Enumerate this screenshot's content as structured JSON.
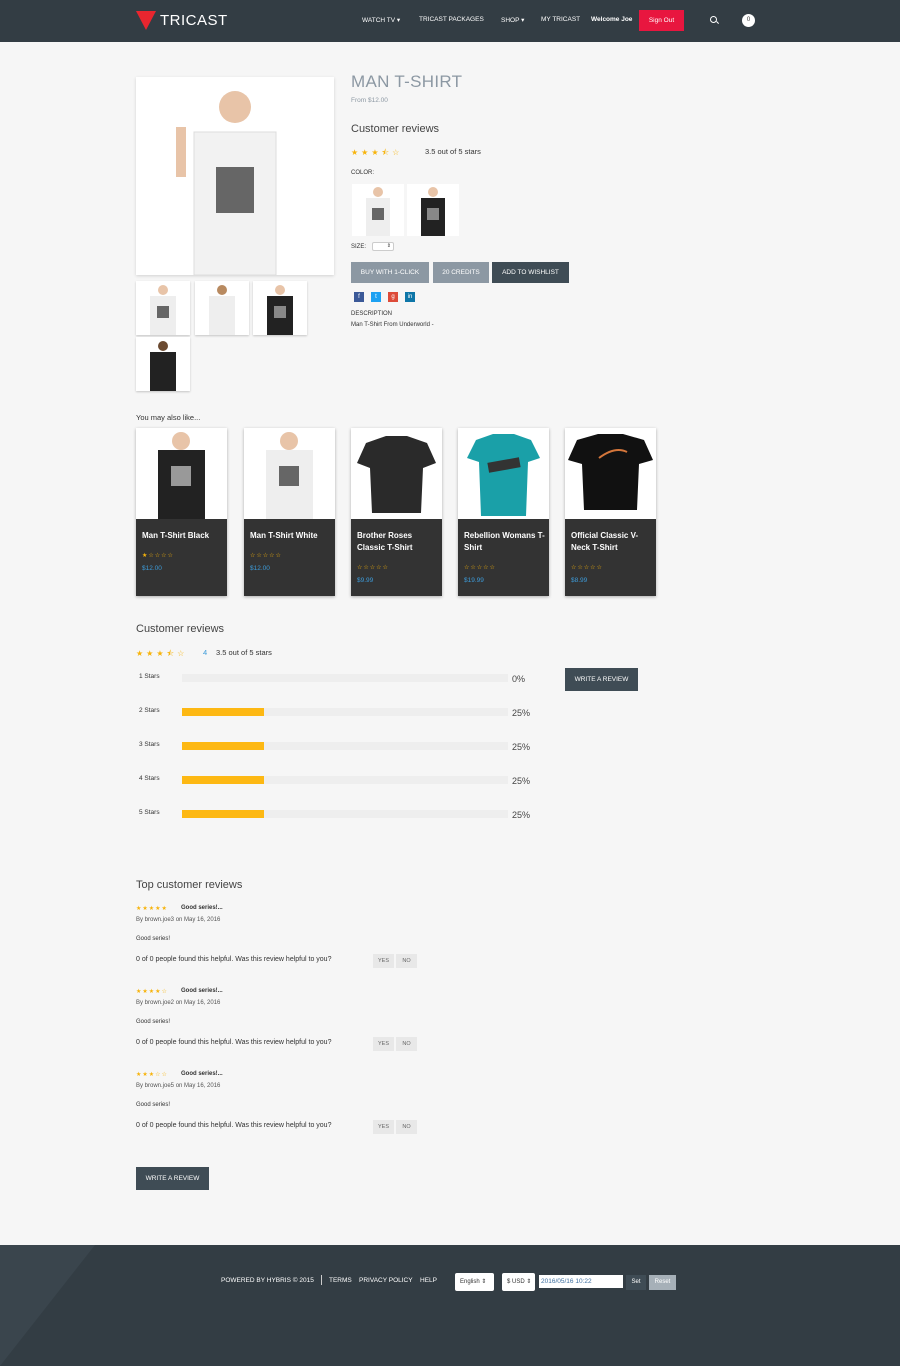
{
  "header": {
    "logo": "TRICAST",
    "nav": [
      "WATCH TV",
      "TRICAST PACKAGES",
      "SHOP",
      "MY TRICAST"
    ],
    "welcome": "Welcome Joe",
    "signout": "Sign Out",
    "cart_count": "0"
  },
  "product": {
    "title": "MAN T-SHIRT",
    "from": "From $12.00",
    "reviews_heading": "Customer reviews",
    "rating_text": "3.5 out of 5 stars",
    "rating": 3.5,
    "color_label": "COLOR:",
    "size_label": "SIZE:",
    "buy_label": "BUY WITH 1-CLICK",
    "credits_label": "20 CREDITS",
    "wishlist_label": "ADD TO WISHLIST",
    "desc_label": "DESCRIPTION",
    "desc_text": "Man T-Shirt From Underworld -"
  },
  "also": {
    "heading": "You may also like...",
    "items": [
      {
        "name": "Man T-Shirt Black",
        "price": "$12.00",
        "rating": 1
      },
      {
        "name": "Man T-Shirt White",
        "price": "$12.00",
        "rating": 0
      },
      {
        "name": "Brother Roses Classic T-Shirt",
        "price": "$9.99",
        "rating": 0
      },
      {
        "name": "Rebellion Womans T-Shirt",
        "price": "$19.99",
        "rating": 0
      },
      {
        "name": "Official Classic V-Neck T-Shirt",
        "price": "$8.99",
        "rating": 0
      }
    ]
  },
  "reviews": {
    "heading": "Customer reviews",
    "count": "4",
    "rating_text": "3.5 out of 5 stars",
    "write_label": "WRITE A REVIEW",
    "bars": [
      {
        "label": "1 Stars",
        "pct": "0%",
        "value": 0
      },
      {
        "label": "2 Stars",
        "pct": "25%",
        "value": 25
      },
      {
        "label": "3 Stars",
        "pct": "25%",
        "value": 25
      },
      {
        "label": "4 Stars",
        "pct": "25%",
        "value": 25
      },
      {
        "label": "5 Stars",
        "pct": "25%",
        "value": 25
      }
    ]
  },
  "top": {
    "heading": "Top customer reviews",
    "helpful": "0 of 0 people found this helpful. Was this review helpful to you?",
    "yes": "YES",
    "no": "NO",
    "write_label": "WRITE A REVIEW",
    "items": [
      {
        "title": "Good series!...",
        "by": "By brown.joe3 on May 16, 2016",
        "body": "Good series!",
        "rating": 5
      },
      {
        "title": "Good series!...",
        "by": "By brown.joe2 on May 16, 2016",
        "body": "Good series!",
        "rating": 4
      },
      {
        "title": "Good series!...",
        "by": "By brown.joe5 on May 16, 2016",
        "body": "Good series!",
        "rating": 3
      }
    ]
  },
  "footer": {
    "powered": "POWERED BY HYBRIS © 2015",
    "terms": "TERMS",
    "privacy": "PRIVACY POLICY",
    "help": "HELP",
    "language": "English",
    "currency": "$ USD",
    "datetime": "2016/05/16 10:22",
    "set": "Set",
    "reset": "Reset"
  }
}
